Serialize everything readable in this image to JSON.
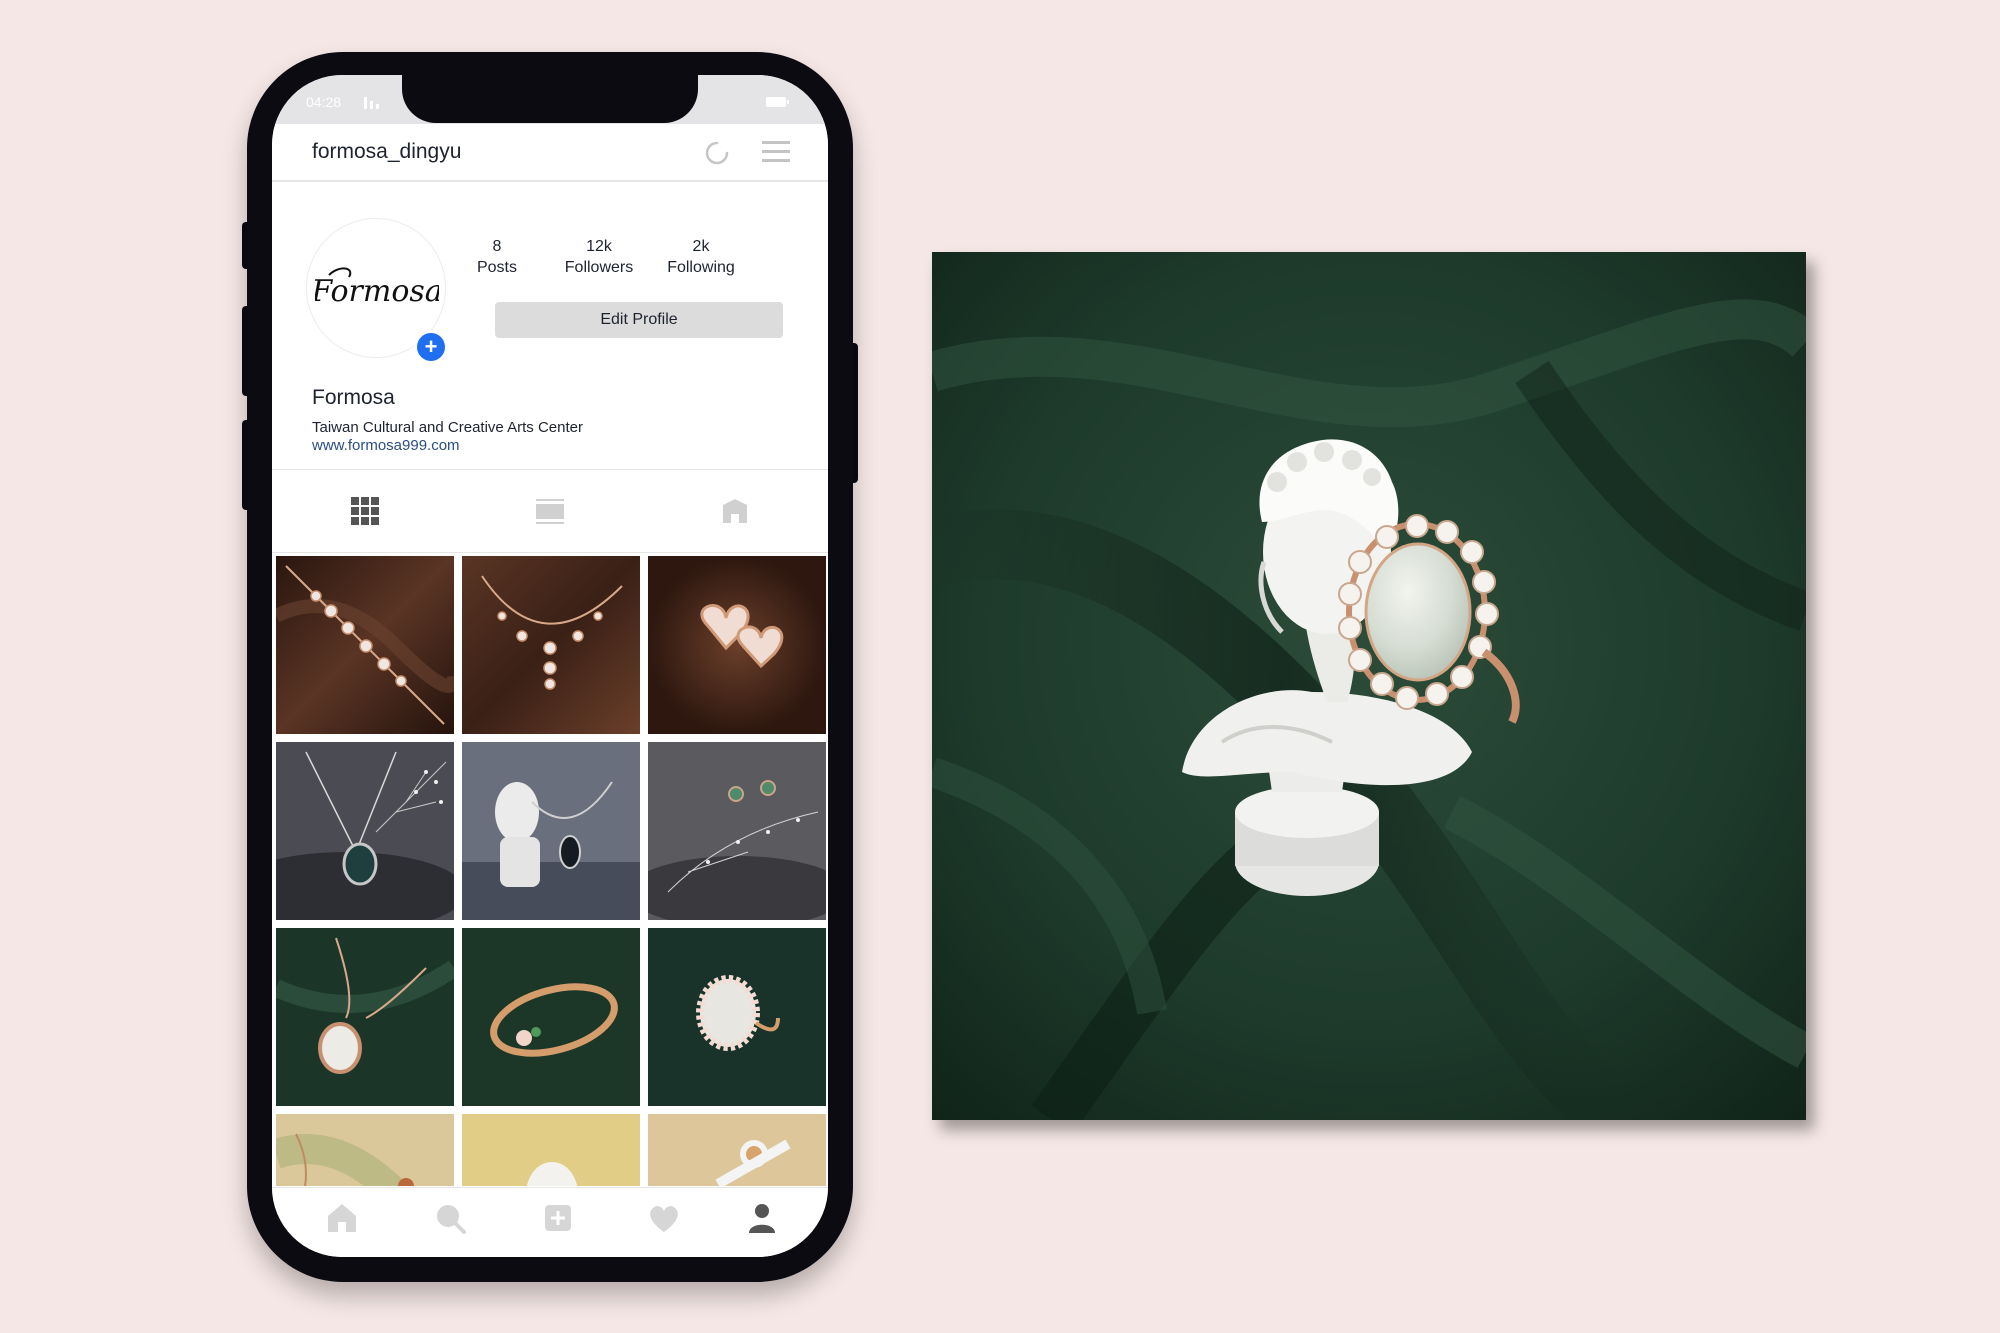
{
  "status": {
    "time": "04:28"
  },
  "header": {
    "username": "formosa_dingyu"
  },
  "profile": {
    "logo_text": "Formosa",
    "stats": [
      {
        "value": "8",
        "label": "Posts"
      },
      {
        "value": "12k",
        "label": "Followers"
      },
      {
        "value": "2k",
        "label": "Following"
      }
    ],
    "edit_label": "Edit Profile",
    "display_name": "Formosa",
    "bio": "Taiwan Cultural and Creative Arts Center",
    "website": "www.formosa999.com"
  },
  "tabs": [
    {
      "icon": "grid-icon",
      "active": true
    },
    {
      "icon": "feed-icon",
      "active": false
    },
    {
      "icon": "tagged-icon",
      "active": false
    }
  ],
  "posts": [
    {
      "subject": "rose gold bracelet with white stones on brown fabric",
      "bg": "#3a2118"
    },
    {
      "subject": "heart pendant necklace on brown fabric",
      "bg": "#432519"
    },
    {
      "subject": "heart stud earrings on brown fabric",
      "bg": "#4a2a1e"
    },
    {
      "subject": "dark jade pendant with baby's breath",
      "bg": "#4f5057"
    },
    {
      "subject": "white bust with dark gemstone necklace",
      "bg": "#5f6472"
    },
    {
      "subject": "green jade drop earrings with baby's breath",
      "bg": "#555357"
    },
    {
      "subject": "jade pendant necklace on green fabric",
      "bg": "#1d3a2b"
    },
    {
      "subject": "gold floral bangle on green fabric",
      "bg": "#1f3a2c"
    },
    {
      "subject": "halo jade ring on green fabric",
      "bg": "#1c3629"
    },
    {
      "subject": "gold necklace on pastel background",
      "bg": "#d9c89b"
    },
    {
      "subject": "white bust on pastel background",
      "bg": "#e3cf8a"
    },
    {
      "subject": "astronaut figurine on pastel background",
      "bg": "#dcc697"
    }
  ],
  "bottom_nav": [
    "home-icon",
    "search-icon",
    "add-post-icon",
    "heart-icon",
    "profile-icon"
  ],
  "feature": {
    "subject": "white bust sculpture with halo jade ring on dark green fabric"
  },
  "colors": {
    "background": "#f5e7e5",
    "phone_frame": "#0c0b12",
    "accent": "#1f6ff0",
    "link": "#2a4d83"
  }
}
